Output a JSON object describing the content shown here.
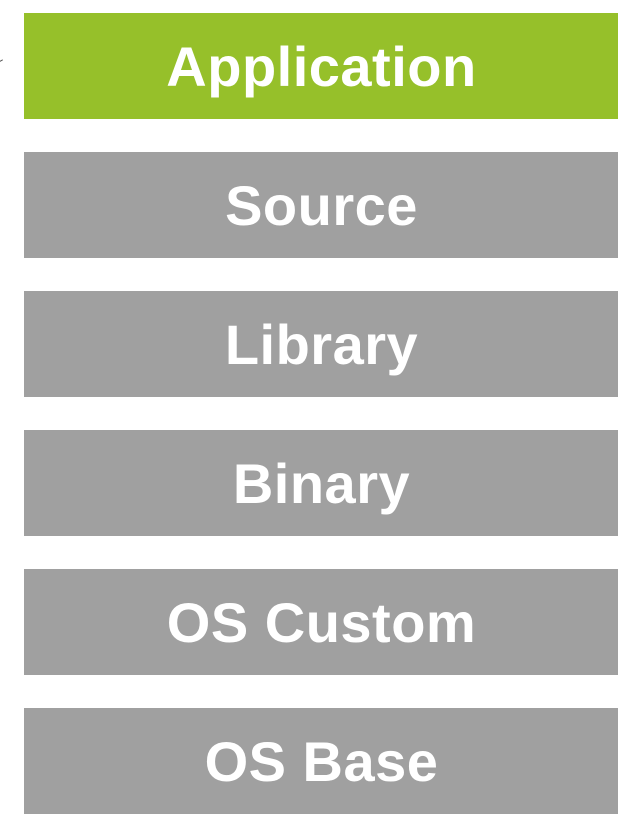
{
  "colors": {
    "active": "#96c02a",
    "inactive": "#a0a0a0",
    "text": "#ffffff"
  },
  "layers": [
    {
      "label": "Application",
      "state": "active"
    },
    {
      "label": "Source",
      "state": "inactive"
    },
    {
      "label": "Library",
      "state": "inactive"
    },
    {
      "label": "Binary",
      "state": "inactive"
    },
    {
      "label": "OS Custom",
      "state": "inactive"
    },
    {
      "label": "OS Base",
      "state": "inactive"
    }
  ]
}
